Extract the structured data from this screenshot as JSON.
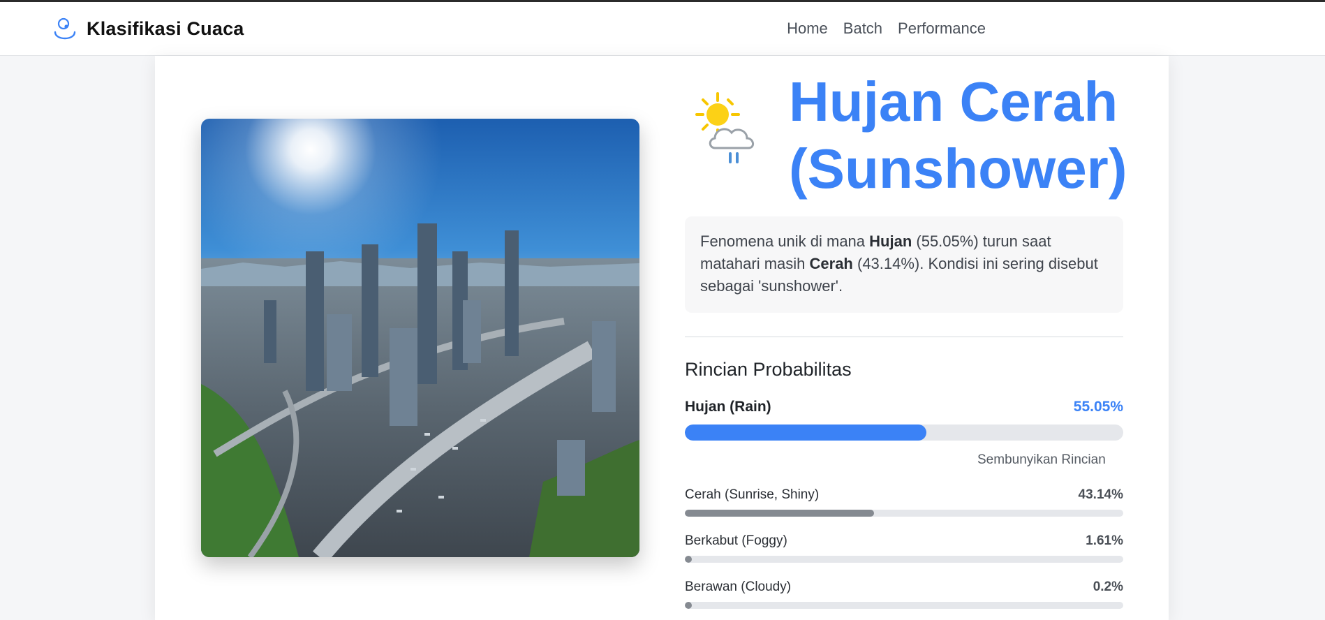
{
  "app": {
    "title": "Klasifikasi Cuaca",
    "brand_icon": "weather-logo-icon"
  },
  "nav": {
    "items": [
      {
        "label": "Home"
      },
      {
        "label": "Batch"
      },
      {
        "label": "Performance"
      }
    ]
  },
  "image": {
    "icon": "city-skyline-photo"
  },
  "result": {
    "icon": "sun-behind-rain-cloud-icon",
    "title_line1": "Hujan Cerah",
    "title_line2": "(Sunshower)",
    "accent_color": "#3b82f6",
    "description": {
      "part1": "Fenomena unik di mana ",
      "bold1": "Hujan",
      "part2": " (55.05%) turun saat matahari masih ",
      "bold2": "Cerah",
      "part3": " (43.14%). Kondisi ini sering disebut sebagai 'sunshower'."
    }
  },
  "probabilities": {
    "heading": "Rincian Probabilitas",
    "top": {
      "label": "Hujan (Rain)",
      "percent_text": "55.05%",
      "value": 55.05
    },
    "toggle_label": "Sembunyikan Rincian",
    "details": [
      {
        "label": "Cerah (Sunrise, Shiny)",
        "percent_text": "43.14%",
        "value": 43.14
      },
      {
        "label": "Berkabut (Foggy)",
        "percent_text": "1.61%",
        "value": 1.61
      },
      {
        "label": "Berawan (Cloudy)",
        "percent_text": "0.2%",
        "value": 0.2
      }
    ]
  }
}
